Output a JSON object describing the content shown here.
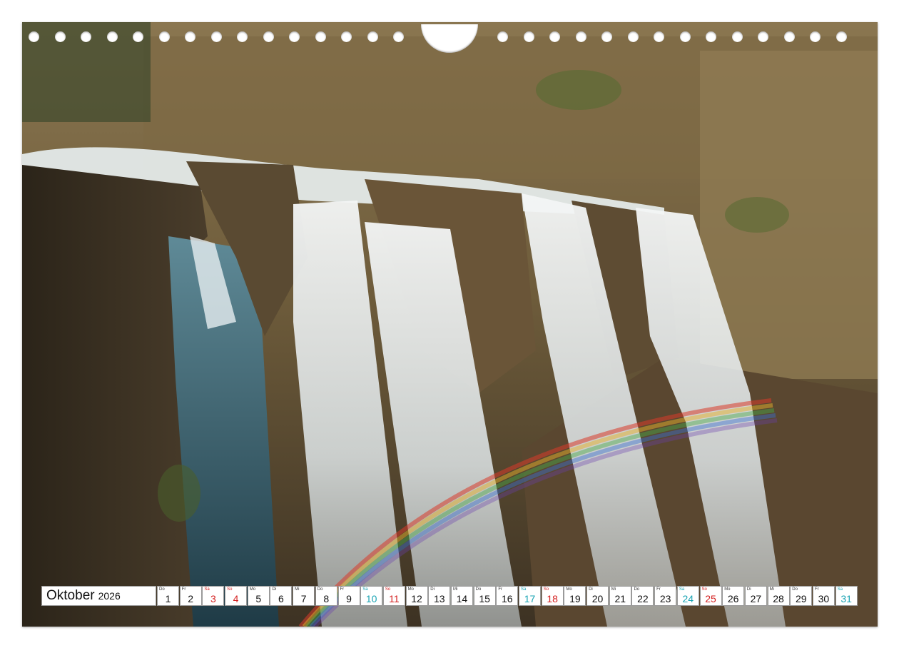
{
  "calendar": {
    "month": "Oktober",
    "year": "2026",
    "days": [
      {
        "dow": "Do",
        "num": "1",
        "kind": "weekday"
      },
      {
        "dow": "Fr",
        "num": "2",
        "kind": "weekday"
      },
      {
        "dow": "Sa",
        "num": "3",
        "kind": "sun"
      },
      {
        "dow": "So",
        "num": "4",
        "kind": "sun"
      },
      {
        "dow": "Mo",
        "num": "5",
        "kind": "weekday"
      },
      {
        "dow": "Di",
        "num": "6",
        "kind": "weekday"
      },
      {
        "dow": "Mi",
        "num": "7",
        "kind": "weekday"
      },
      {
        "dow": "Do",
        "num": "8",
        "kind": "weekday"
      },
      {
        "dow": "Fr",
        "num": "9",
        "kind": "weekday"
      },
      {
        "dow": "Sa",
        "num": "10",
        "kind": "sat"
      },
      {
        "dow": "So",
        "num": "11",
        "kind": "sun"
      },
      {
        "dow": "Mo",
        "num": "12",
        "kind": "weekday"
      },
      {
        "dow": "Di",
        "num": "13",
        "kind": "weekday"
      },
      {
        "dow": "Mi",
        "num": "14",
        "kind": "weekday"
      },
      {
        "dow": "Do",
        "num": "15",
        "kind": "weekday"
      },
      {
        "dow": "Fr",
        "num": "16",
        "kind": "weekday"
      },
      {
        "dow": "Sa",
        "num": "17",
        "kind": "sat"
      },
      {
        "dow": "So",
        "num": "18",
        "kind": "sun"
      },
      {
        "dow": "Mo",
        "num": "19",
        "kind": "weekday"
      },
      {
        "dow": "Di",
        "num": "20",
        "kind": "weekday"
      },
      {
        "dow": "Mi",
        "num": "21",
        "kind": "weekday"
      },
      {
        "dow": "Do",
        "num": "22",
        "kind": "weekday"
      },
      {
        "dow": "Fr",
        "num": "23",
        "kind": "weekday"
      },
      {
        "dow": "Sa",
        "num": "24",
        "kind": "sat"
      },
      {
        "dow": "So",
        "num": "25",
        "kind": "sun"
      },
      {
        "dow": "Mo",
        "num": "26",
        "kind": "weekday"
      },
      {
        "dow": "Di",
        "num": "27",
        "kind": "weekday"
      },
      {
        "dow": "Mi",
        "num": "28",
        "kind": "weekday"
      },
      {
        "dow": "Do",
        "num": "29",
        "kind": "weekday"
      },
      {
        "dow": "Fr",
        "num": "30",
        "kind": "weekday"
      },
      {
        "dow": "Sa",
        "num": "31",
        "kind": "sat"
      }
    ]
  },
  "colors": {
    "saturday": "#18a3b3",
    "sunday": "#d41f1f",
    "weekday": "#111111"
  },
  "binding": {
    "hole_count": 32
  }
}
